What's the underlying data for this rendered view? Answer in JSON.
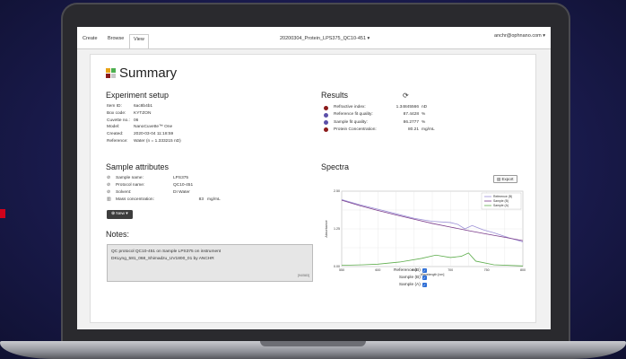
{
  "nav": {
    "tabs": [
      "Create",
      "Browse",
      "View"
    ],
    "active_tab": "View",
    "document_title": "20200304_Protein_LPS375_QC10-451 ▾",
    "user": "anchr@ophnano.com ▾"
  },
  "summary": {
    "title": "Summary"
  },
  "experiment_setup": {
    "heading": "Experiment setup",
    "rows": [
      {
        "label": "Item ID:",
        "value": "6ac8b4b1"
      },
      {
        "label": "Box code:",
        "value": "KYTZON"
      },
      {
        "label": "Cuvette no.:",
        "value": "06"
      },
      {
        "label": "Model:",
        "value": "NanoCuvette™ One"
      },
      {
        "label": "Created:",
        "value": "2020-03-04 11:18:59"
      },
      {
        "label": "Reference:",
        "value": "Water (n = 1.333215 nD)"
      }
    ]
  },
  "results": {
    "heading": "Results",
    "rows": [
      {
        "label": "Refractive index:",
        "value": "1.34845566",
        "unit": "nD",
        "color": "#8b1a1a"
      },
      {
        "label": "Reference fit quality:",
        "value": "87.4428",
        "unit": "%",
        "color": "#5b4fa8"
      },
      {
        "label": "Sample fit quality:",
        "value": "86.2777",
        "unit": "%",
        "color": "#5b4fa8"
      },
      {
        "label": "Protein Concentration:",
        "value": "80.21",
        "unit": "mg/mL",
        "color": "#8b1a1a"
      }
    ]
  },
  "sample_attributes": {
    "heading": "Sample attributes",
    "rows": [
      {
        "icon": "tag-icon",
        "label": "Sample name:",
        "value": "LPS375",
        "unit": ""
      },
      {
        "icon": "tag-icon",
        "label": "Protocol name:",
        "value": "QC10-451",
        "unit": ""
      },
      {
        "icon": "tag-icon",
        "label": "Solvent:",
        "value": "DI Water",
        "unit": ""
      },
      {
        "icon": "chart-icon",
        "label": "Mass concentration:",
        "value": "83",
        "unit": "mg/mL"
      }
    ],
    "new_button": "⊕ New ▾"
  },
  "notes": {
    "heading": "Notes:",
    "text_line1": "QC protocol QC10-451 on Sample LPS375 on instrument",
    "text_line2": "DKLyng_581_068_Shimadzu_UV1800_01 by ANCHR",
    "counter": "[94/583]"
  },
  "spectra": {
    "heading": "Spectra",
    "export_label": "Export",
    "legend_checks": [
      "Reference (B)",
      "Sample (B)",
      "Sample (A)"
    ]
  },
  "chart_data": {
    "type": "line",
    "xlabel": "Wavelength [nm]",
    "ylabel": "Absorbance",
    "xlim": [
      550,
      800
    ],
    "ylim": [
      0.0,
      2.5
    ],
    "x_ticks": [
      550,
      575,
      600,
      625,
      650,
      675,
      700,
      725,
      750,
      775,
      800
    ],
    "x_tick_labels": [
      "550",
      "",
      "600",
      "",
      "650",
      "",
      "700",
      "",
      "750",
      "",
      "800"
    ],
    "y_ticks": [
      0.0,
      0.625,
      1.25,
      1.875,
      2.5
    ],
    "y_tick_labels": [
      "0.00",
      "",
      "1.25",
      "",
      "2.50"
    ],
    "legend": [
      "Reference (B)",
      "Sample (B)",
      "Sample (A)"
    ],
    "series": [
      {
        "name": "Reference (B)",
        "color": "#9b8fd6",
        "x": [
          550,
          575,
          600,
          625,
          650,
          675,
          700,
          710,
          720,
          730,
          745,
          760,
          780,
          800
        ],
        "y": [
          2.22,
          2.05,
          1.9,
          1.75,
          1.6,
          1.5,
          1.46,
          1.4,
          1.25,
          1.36,
          1.22,
          1.12,
          0.96,
          0.82
        ]
      },
      {
        "name": "Sample (B)",
        "color": "#7a3a8a",
        "x": [
          550,
          575,
          600,
          625,
          650,
          675,
          700,
          725,
          750,
          775,
          800
        ],
        "y": [
          2.2,
          2.02,
          1.86,
          1.71,
          1.57,
          1.43,
          1.31,
          1.19,
          1.08,
          0.97,
          0.86
        ]
      },
      {
        "name": "Sample (A)",
        "color": "#5fae4e",
        "x": [
          550,
          580,
          600,
          630,
          660,
          680,
          700,
          715,
          725,
          735,
          760,
          800
        ],
        "y": [
          0.04,
          0.06,
          0.08,
          0.15,
          0.27,
          0.38,
          0.3,
          0.34,
          0.45,
          0.18,
          0.06,
          0.02
        ]
      }
    ]
  }
}
